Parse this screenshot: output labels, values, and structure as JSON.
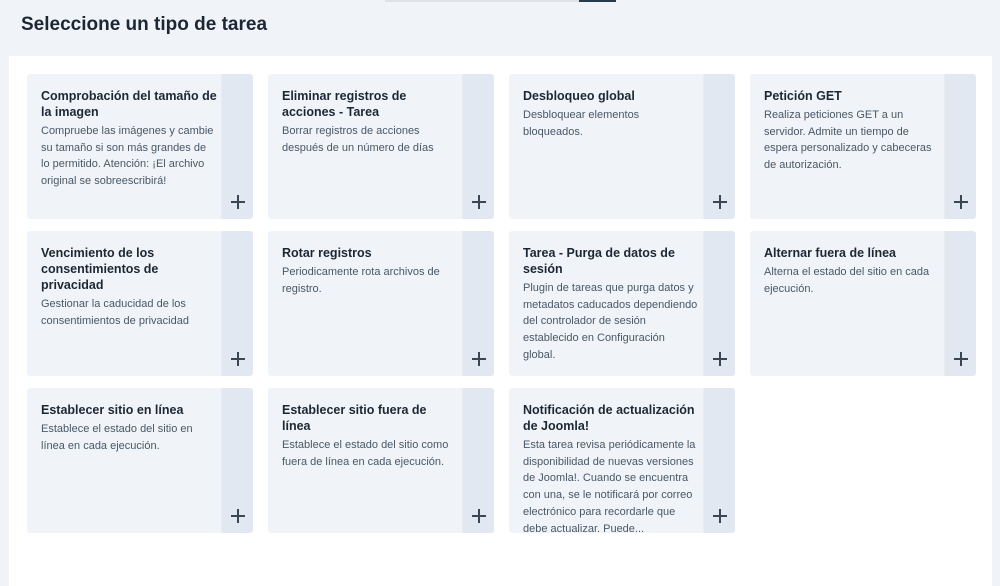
{
  "page": {
    "title": "Seleccione un tipo de tarea"
  },
  "colors": {
    "background": "#f0f4f9",
    "card": "#f0f4f9",
    "card_add_strip": "#e2e8f1",
    "title_text": "#1d2733",
    "description_text": "#495766"
  },
  "cards": [
    {
      "title": "Comprobación del tamaño de la imagen",
      "description": "Compruebe las imágenes y cambie su tamaño si son más grandes de lo permitido. Atención: ¡El archivo original se sobreescribirá!",
      "icon": "plus-icon"
    },
    {
      "title": "Eliminar registros de acciones - Tarea",
      "description": "Borrar registros de acciones después de un número de días",
      "icon": "plus-icon"
    },
    {
      "title": "Desbloqueo global",
      "description": "Desbloquear elementos bloqueados.",
      "icon": "plus-icon"
    },
    {
      "title": "Petición GET",
      "description": "Realiza peticiones GET a un servidor. Admite un tiempo de espera personalizado y cabeceras de autorización.",
      "icon": "plus-icon"
    },
    {
      "title": "Vencimiento de los consentimientos de privacidad",
      "description": "Gestionar la caducidad de los consentimientos de privacidad",
      "icon": "plus-icon"
    },
    {
      "title": "Rotar registros",
      "description": "Periodicamente rota archivos de registro.",
      "icon": "plus-icon"
    },
    {
      "title": "Tarea - Purga de datos de sesión",
      "description": "Plugin de tareas que purga datos y metadatos caducados dependiendo del controlador de sesión establecido en Configuración global.",
      "icon": "plus-icon"
    },
    {
      "title": "Alternar fuera de línea",
      "description": "Alterna el estado del sitio en cada ejecución.",
      "icon": "plus-icon"
    },
    {
      "title": "Establecer sitio en línea",
      "description": "Establece el estado del sitio en línea en cada ejecución.",
      "icon": "plus-icon"
    },
    {
      "title": "Establecer sitio fuera de línea",
      "description": "Establece el estado del sitio como fuera de línea en cada ejecución.",
      "icon": "plus-icon"
    },
    {
      "title": "Notificación de actualización de Joomla!",
      "description": "Esta tarea revisa periódicamente la disponibilidad de nuevas versiones de Joomla!. Cuando se encuentra con una, se le notificará por correo electrónico para recordarle que debe actualizar. Puede...",
      "icon": "plus-icon"
    }
  ]
}
